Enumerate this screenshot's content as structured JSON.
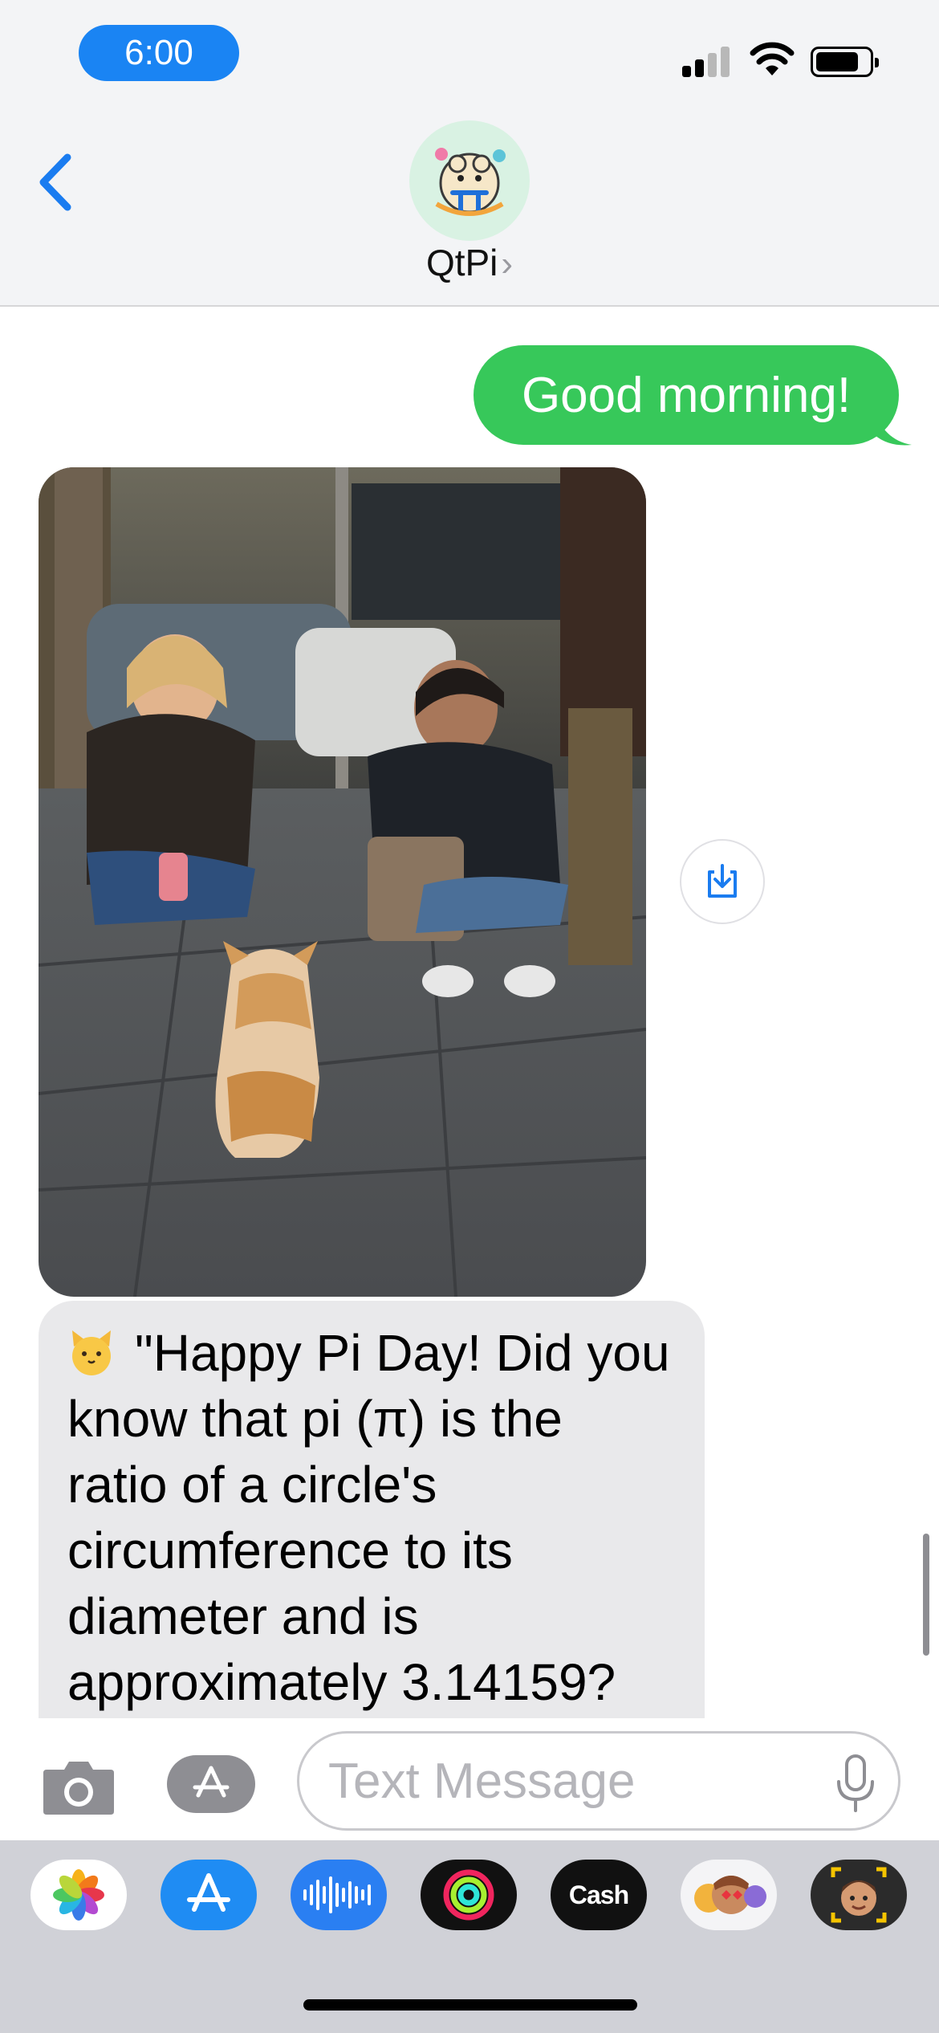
{
  "status_bar": {
    "time": "6:00"
  },
  "header": {
    "contact_name": "QtPi",
    "contact_chevron": "›"
  },
  "messages": [
    {
      "direction": "sent",
      "text": "Good morning!"
    },
    {
      "direction": "received",
      "type": "photo",
      "description_icon": "photo-attachment"
    },
    {
      "direction": "received",
      "emoji": "cat-face-icon",
      "text": "\"Happy Pi Day! Did you know that pi (π) is the ratio of a circle's circumference to its diameter and is approximately 3.14159?"
    }
  ],
  "composer": {
    "placeholder": "Text Message"
  },
  "app_drawer": {
    "apps": [
      {
        "name": "photos-app-icon"
      },
      {
        "name": "app-store-app-icon"
      },
      {
        "name": "audio-message-app-icon"
      },
      {
        "name": "fitness-app-icon"
      },
      {
        "name": "apple-cash-app-icon",
        "label": "Cash"
      },
      {
        "name": "memoji-stickers-app-icon"
      },
      {
        "name": "memoji-app-icon"
      }
    ]
  },
  "colors": {
    "sent_bubble": "#37c85a",
    "received_bubble": "#e9e9eb",
    "accent_blue": "#1a84f3"
  }
}
